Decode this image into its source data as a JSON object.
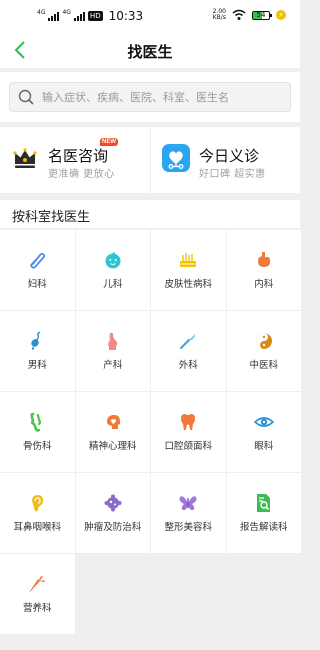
{
  "status_bar": {
    "signal1": "4G",
    "signal2": "4G",
    "hd": "HD",
    "time": "10:33",
    "net_rate_value": "2.00",
    "net_rate_unit": "KB/s",
    "battery": "54"
  },
  "nav": {
    "title": "找医生",
    "back_icon": "chevron-left-icon",
    "accent_color": "#2cbd4e"
  },
  "search": {
    "placeholder": "输入症状、疾病、医院、科室、医生名"
  },
  "features": [
    {
      "title": "名医咨询",
      "badge": "NEW",
      "subtitle": "更准确  更放心",
      "icon": "crown-icon"
    },
    {
      "title": "今日义诊",
      "subtitle": "好口碑  超实惠",
      "icon": "heart-stethoscope-icon"
    }
  ],
  "section": {
    "title": "按科室找医生"
  },
  "departments": [
    {
      "label": "妇科",
      "icon": "paperclip-icon"
    },
    {
      "label": "儿科",
      "icon": "baby-face-icon"
    },
    {
      "label": "皮肤性病科",
      "icon": "skin-icon"
    },
    {
      "label": "内科",
      "icon": "stomach-icon"
    },
    {
      "label": "男科",
      "icon": "sperm-icon"
    },
    {
      "label": "产科",
      "icon": "pregnant-icon"
    },
    {
      "label": "外科",
      "icon": "scalpel-icon"
    },
    {
      "label": "中医科",
      "icon": "yin-yang-icon"
    },
    {
      "label": "骨伤科",
      "icon": "bone-joint-icon"
    },
    {
      "label": "精神心理科",
      "icon": "head-heart-icon"
    },
    {
      "label": "口腔颌面科",
      "icon": "tooth-icon"
    },
    {
      "label": "眼科",
      "icon": "eye-icon"
    },
    {
      "label": "耳鼻咽喉科",
      "icon": "ear-icon"
    },
    {
      "label": "肿瘤及防治科",
      "icon": "tumor-cell-icon"
    },
    {
      "label": "整形美容科",
      "icon": "butterfly-icon"
    },
    {
      "label": "报告解读科",
      "icon": "report-magnifier-icon"
    },
    {
      "label": "营养科",
      "icon": "carrot-icon"
    }
  ]
}
